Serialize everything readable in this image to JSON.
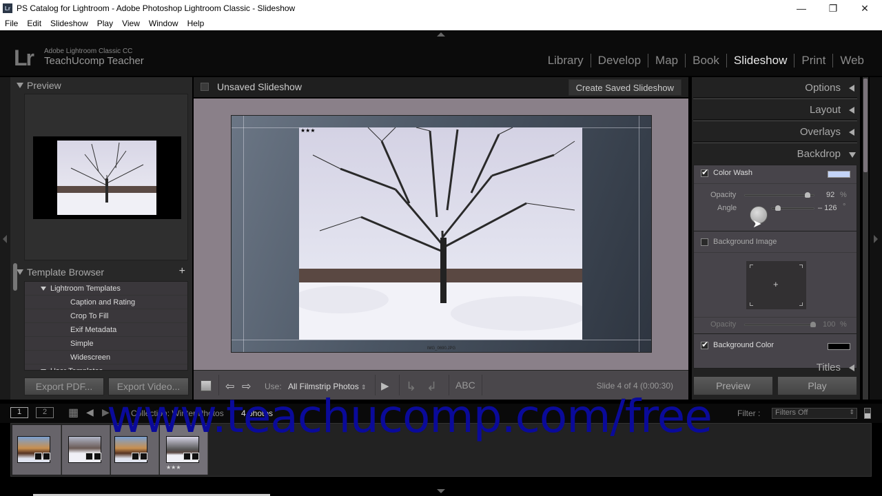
{
  "window": {
    "title": "PS Catalog for Lightroom - Adobe Photoshop Lightroom Classic - Slideshow",
    "app_icon": "Lr",
    "controls": {
      "minimize": "—",
      "maximize": "❐",
      "close": "✕"
    }
  },
  "menu": [
    "File",
    "Edit",
    "Slideshow",
    "Play",
    "View",
    "Window",
    "Help"
  ],
  "identity": {
    "logo": "Lr",
    "product": "Adobe Lightroom Classic CC",
    "user": "TeachUcomp Teacher"
  },
  "modules": {
    "items": [
      "Library",
      "Develop",
      "Map",
      "Book",
      "Slideshow",
      "Print",
      "Web"
    ],
    "active": "Slideshow"
  },
  "left_panel": {
    "preview": {
      "title": "Preview"
    },
    "template_browser": {
      "title": "Template Browser",
      "add_icon": "+",
      "folder": "Lightroom Templates",
      "items": [
        "Caption and Rating",
        "Crop To Fill",
        "Exif Metadata",
        "Simple",
        "Widescreen"
      ],
      "next_folder_partial": "User Templates"
    },
    "buttons": {
      "export_pdf": "Export PDF...",
      "export_video": "Export Video..."
    }
  },
  "center": {
    "title": "Unsaved Slideshow",
    "create_button": "Create Saved Slideshow",
    "slide": {
      "rating_stars": "★★★",
      "caption": "IMG_0690.JPG"
    },
    "toolbar": {
      "use_label": "Use:",
      "use_value": "All Filmstrip Photos",
      "abc_label": "ABC",
      "status": "Slide 4 of 4 (0:00:30)"
    }
  },
  "right_panel": {
    "sections": [
      {
        "label": "Options",
        "expanded": false
      },
      {
        "label": "Layout",
        "expanded": false
      },
      {
        "label": "Overlays",
        "expanded": false
      },
      {
        "label": "Backdrop",
        "expanded": true
      },
      {
        "label": "Titles",
        "expanded": false
      }
    ],
    "backdrop": {
      "color_wash": {
        "label": "Color Wash",
        "checked": true,
        "color": "#c4d4f8"
      },
      "opacity": {
        "label": "Opacity",
        "value": "92",
        "unit": "%",
        "fraction": 0.92
      },
      "angle": {
        "label": "Angle",
        "value": "– 126",
        "unit": "°"
      },
      "background_image": {
        "label": "Background Image",
        "checked": false
      },
      "bg_opacity": {
        "label": "Opacity",
        "value": "100",
        "unit": "%",
        "fraction": 1.0
      },
      "background_color": {
        "label": "Background Color",
        "checked": true,
        "color": "#000000"
      }
    },
    "buttons": {
      "preview": "Preview",
      "play": "Play"
    }
  },
  "filmstrip": {
    "view1": "1",
    "view2": "2",
    "source": "Collection: Winter Photos",
    "count": "4 photos",
    "filter_label": "Filter :",
    "filter_value": "Filters Off",
    "thumbnails": [
      {
        "stars": ""
      },
      {
        "stars": ""
      },
      {
        "stars": ""
      },
      {
        "stars": "★★★"
      }
    ]
  },
  "watermark": "www.teachucomp.com/free"
}
